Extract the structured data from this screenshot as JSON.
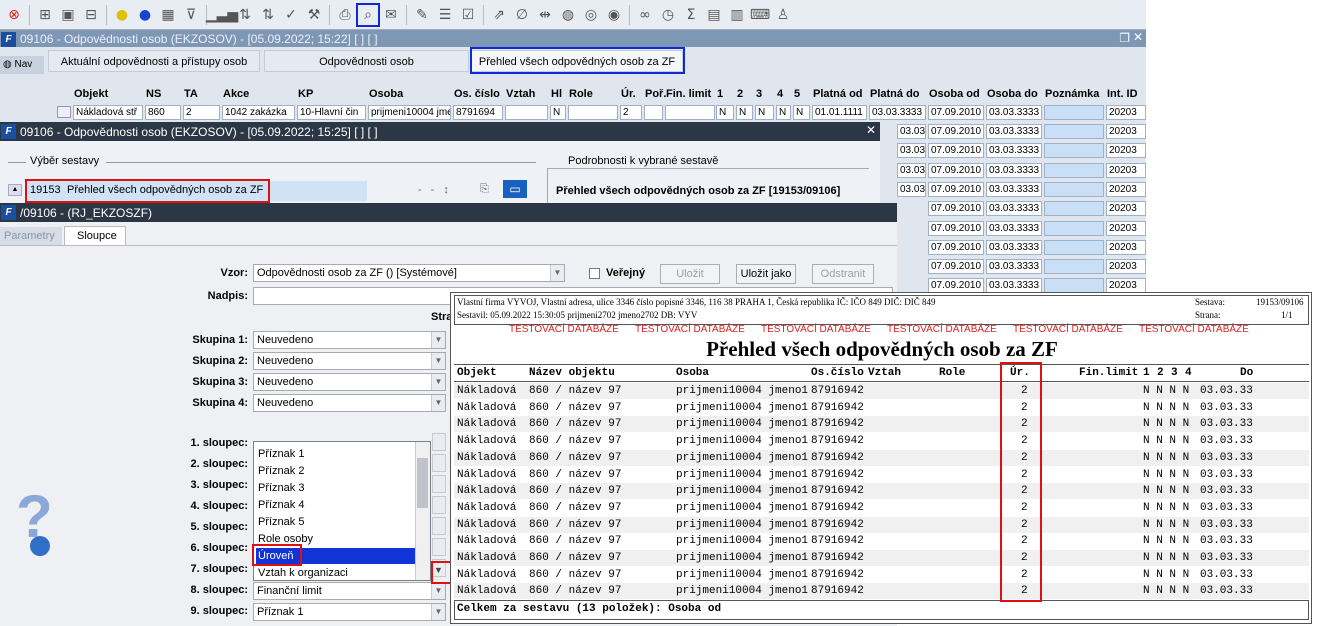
{
  "toolbar": {
    "icons": [
      "close-icon",
      "add-icon",
      "save-icon",
      "remove-icon",
      "help-icon",
      "play-icon",
      "calendar-icon",
      "filter-icon",
      "chart-icon",
      "sort-asc-icon",
      "sort-desc-icon",
      "check-icon",
      "wrench-icon",
      "print-icon",
      "print-preview-icon",
      "mail-icon",
      "edit-icon",
      "list-icon",
      "checklist-icon",
      "export-icon",
      "attach-icon",
      "split-icon",
      "globe-icon",
      "compass-icon",
      "eye-icon",
      "glasses-icon",
      "clock-icon",
      "sum-icon",
      "excel-icon",
      "word-icon",
      "keyboard-icon",
      "person-icon"
    ]
  },
  "win1": {
    "title": "09106 - Odpovědnosti osob (EKZOSOV) - [05.09.2022; 15:22]  [ ]  [ ]",
    "nav": "Nav",
    "tabs": [
      "Aktuální odpovědnosti a přístupy osob",
      "Odpovědnosti osob",
      "Přehled všech odpovědných osob za ZF"
    ],
    "columns": [
      "Objekt",
      "NS",
      "TA",
      "Akce",
      "KP",
      "Osoba",
      "Os. číslo",
      "Vztah",
      "Hl",
      "Role",
      "Úr.",
      "Poř.",
      "Fin. limit",
      "1",
      "2",
      "3",
      "4",
      "5",
      "Platná od",
      "Platná do",
      "Osoba od",
      "Osoba do",
      "Poznámka",
      "Int. ID"
    ],
    "row1": [
      "Nákladová stř",
      "860",
      "2",
      "1042 zakázka",
      "10-Hlavní čin",
      "prijmeni10004 jme",
      "8791694",
      "",
      "N",
      "",
      "2",
      "",
      "",
      "N",
      "N",
      "N",
      "N",
      "N",
      "01.01.1111",
      "03.03.3333",
      "07.09.2010",
      "03.03.3333",
      "",
      "20203"
    ],
    "right_rows": {
      "platna_do": "03.03.3333",
      "osoba_od": "07.09.2010",
      "osoba_do": "03.03.3333",
      "int_id": "20203"
    }
  },
  "win2": {
    "title": "09106 - Odpovědnosti osob (EKZOSOV) - [05.09.2022; 15:25]  [ ]  [ ]",
    "group_left": "Výběr sestavy",
    "group_right": "Podrobnosti k vybrané sestavě",
    "report_id": "19153",
    "report_name": "Přehled všech odpovědných osob za ZF",
    "detail": "Přehled všech odpovědných osob za ZF [19153/09106]"
  },
  "win3": {
    "title": "/09106 - (RJ_EKZOSZF)",
    "tabs": [
      "Parametry",
      "Sloupce"
    ],
    "vzor_label": "Vzor:",
    "vzor_value": "Odpovědnosti osob za ZF  ()  [Systémové]",
    "verejny": "Veřejný",
    "btn_ulozit": "Uložit",
    "btn_ulozit_jako": "Uložit jako",
    "btn_odstranit": "Odstranit",
    "nadpis_label": "Nadpis:",
    "stra": "Stra",
    "groups": [
      {
        "label": "Skupina 1:",
        "value": "Neuvedeno"
      },
      {
        "label": "Skupina 2:",
        "value": "Neuvedeno"
      },
      {
        "label": "Skupina 3:",
        "value": "Neuvedeno"
      },
      {
        "label": "Skupina 4:",
        "value": "Neuvedeno"
      }
    ],
    "columns": [
      "1. sloupec:",
      "2. sloupec:",
      "3. sloupec:",
      "4. sloupec:",
      "5. sloupec:",
      "6. sloupec:",
      "7. sloupec:",
      "8. sloupec:",
      "9. sloupec:"
    ],
    "col8_value": "Finanční limit",
    "col9_value": "Příznak 1",
    "dropdown": [
      "Příznak 1",
      "Příznak 2",
      "Příznak 3",
      "Příznak 4",
      "Příznak 5",
      "Role osoby",
      "Úroveň",
      "Vztah k organizaci"
    ]
  },
  "report": {
    "header_left1": "Vlastní firma VYVOJ, Vlastní adresa, ulice 3346 číslo popisné 3346, 116 38 PRAHA 1, Česká republika  IČ: IČO 849  DIČ: DIČ 849",
    "header_left2": "Sestavil: 05.09.2022 15:30:05 prijmeni2702 jmeno2702  DB: VYV",
    "sestava_label": "Sestava:",
    "sestava_value": "19153/09106",
    "strana_label": "Strana:",
    "strana_value": "1/1",
    "test_db": "TESTOVACÍ DATABÁZE",
    "title": "Přehled všech odpovědných osob za ZF",
    "col_headers": [
      "Objekt",
      "Název objektu",
      "Osoba",
      "Os.číslo",
      "Vztah",
      "Role",
      "Úr.",
      "Fin.limit",
      "1",
      "2",
      "3",
      "4",
      "Do"
    ],
    "row": {
      "objekt": "Nákladová",
      "nazev": "860 / název 97",
      "osoba": "prijmeni10004 jmeno1",
      "cislo": "87916942",
      "ur": "2",
      "flags": "N N N N",
      "do": "03.03.33"
    },
    "row_count": 13,
    "footer": "Celkem za sestavu (13 položek): Osoba od"
  }
}
